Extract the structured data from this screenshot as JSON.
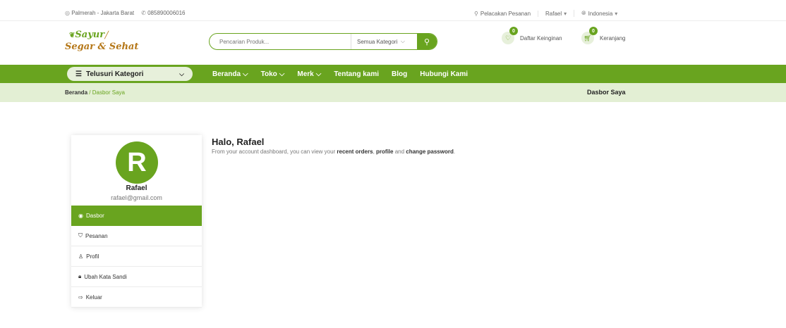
{
  "topbar": {
    "address": "Palmerah - Jakarta Barat",
    "phone": "085890006016",
    "tracking": "Pelacakan Pesanan",
    "user": "Rafael",
    "language": "Indonesia"
  },
  "header": {
    "logo_line1": "Sayur",
    "logo_line2": "Segar & Sehat",
    "search_placeholder": "Pencarian Produk...",
    "category_select": "Semua Kategori",
    "wishlist_label": "Daftar Keinginan",
    "wishlist_count": "0",
    "cart_label": "Keranjang",
    "cart_count": "0"
  },
  "nav": {
    "browse": "Telusuri Kategori",
    "links": [
      "Beranda",
      "Toko",
      "Merk",
      "Tentang kami",
      "Blog",
      "Hubungi Kami"
    ]
  },
  "breadcrumb": {
    "home": "Beranda",
    "sep": "/",
    "current": "Dasbor Saya",
    "page_title": "Dasbor Saya"
  },
  "profile": {
    "initial": "R",
    "name": "Rafael",
    "email": "rafael@gmail.com"
  },
  "menu": [
    {
      "label": "Dasbor"
    },
    {
      "label": "Pesanan"
    },
    {
      "label": "Profil"
    },
    {
      "label": "Ubah Kata Sandi"
    },
    {
      "label": "Keluar"
    }
  ],
  "main": {
    "greeting": "Halo, Rafael",
    "desc_1": "From your account dashboard, you can view your ",
    "desc_recent": "recent orders",
    "desc_2": ", ",
    "desc_profile": "profile",
    "desc_3": " and ",
    "desc_password": "change password",
    "desc_4": "."
  },
  "colors": {
    "accent": "#69a41f",
    "accent_light": "#e3efd4",
    "logo_brown": "#b57718"
  },
  "icons": {
    "location": "location-icon",
    "phone": "phone-icon",
    "tracking": "pin-icon",
    "language": "globe-icon",
    "search": "search-icon",
    "wishlist": "heart-icon",
    "cart": "cart-icon",
    "menu": "hamburger-icon"
  }
}
